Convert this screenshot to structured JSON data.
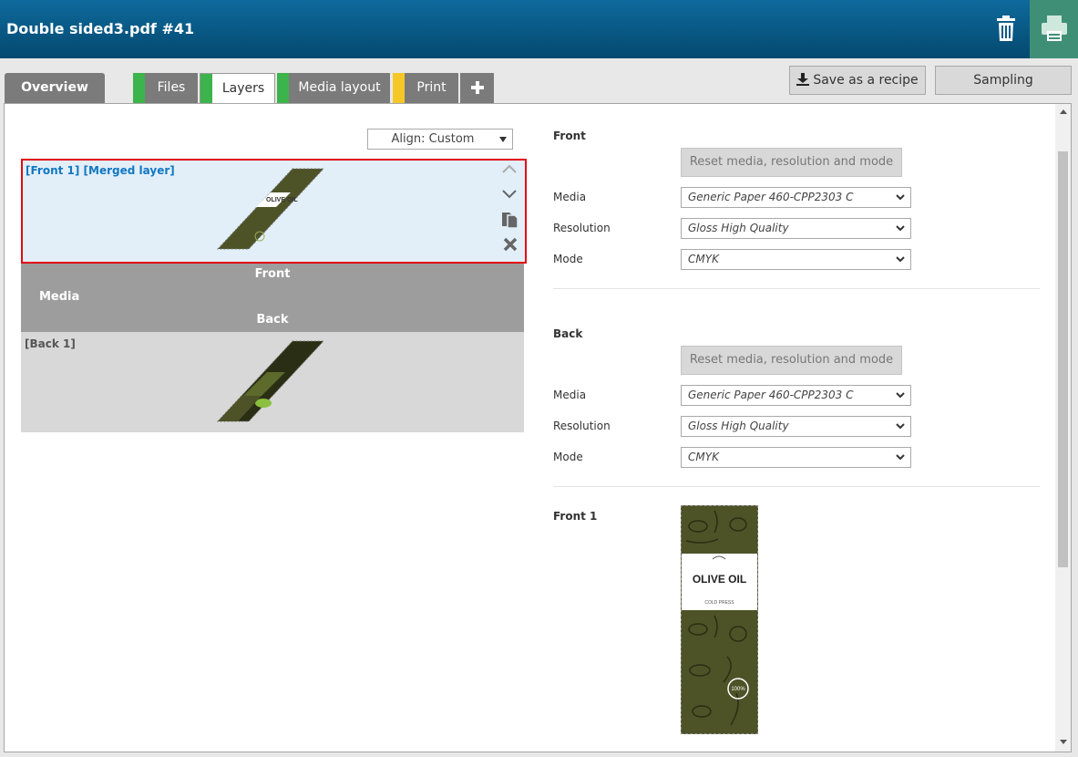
{
  "window": {
    "title": "Double sided3.pdf #41"
  },
  "tabs": [
    {
      "label": "Overview"
    },
    {
      "label": "Files",
      "color": "#3cb44b"
    },
    {
      "label": "Layers",
      "color": "#3cb44b"
    },
    {
      "label": "Media layout",
      "color": "#3cb44b"
    },
    {
      "label": "Print",
      "color": "#f5c828"
    }
  ],
  "toolbar": {
    "save_recipe_label": "Save as a recipe",
    "sampling_label": "Sampling"
  },
  "layers": {
    "align_value": "Align: Custom",
    "front_layer_label": "[Front 1] [Merged layer]",
    "back_layer_label": "[Back 1]",
    "mediabar": {
      "front": "Front",
      "media": "Media",
      "back": "Back"
    }
  },
  "settings": {
    "front": {
      "heading": "Front",
      "reset_label": "Reset media, resolution and mode",
      "media_label": "Media",
      "media_value": "Generic Paper 460-CPP2303 C",
      "resolution_label": "Resolution",
      "resolution_value": "Gloss High Quality",
      "mode_label": "Mode",
      "mode_value": "CMYK"
    },
    "back": {
      "heading": "Back",
      "reset_label": "Reset media, resolution and mode",
      "media_label": "Media",
      "media_value": "Generic Paper 460-CPP2303 C",
      "resolution_label": "Resolution",
      "resolution_value": "Gloss High Quality",
      "mode_label": "Mode",
      "mode_value": "CMYK"
    },
    "preview": {
      "heading": "Front 1",
      "label_title": "OLIVE OIL",
      "label_sub": "COLD PRESS",
      "badge": "100%"
    }
  },
  "colors": {
    "accent": "#1277c2",
    "titlebar": "#04496f",
    "print_button": "#3f8f76",
    "selection": "#e30613"
  }
}
